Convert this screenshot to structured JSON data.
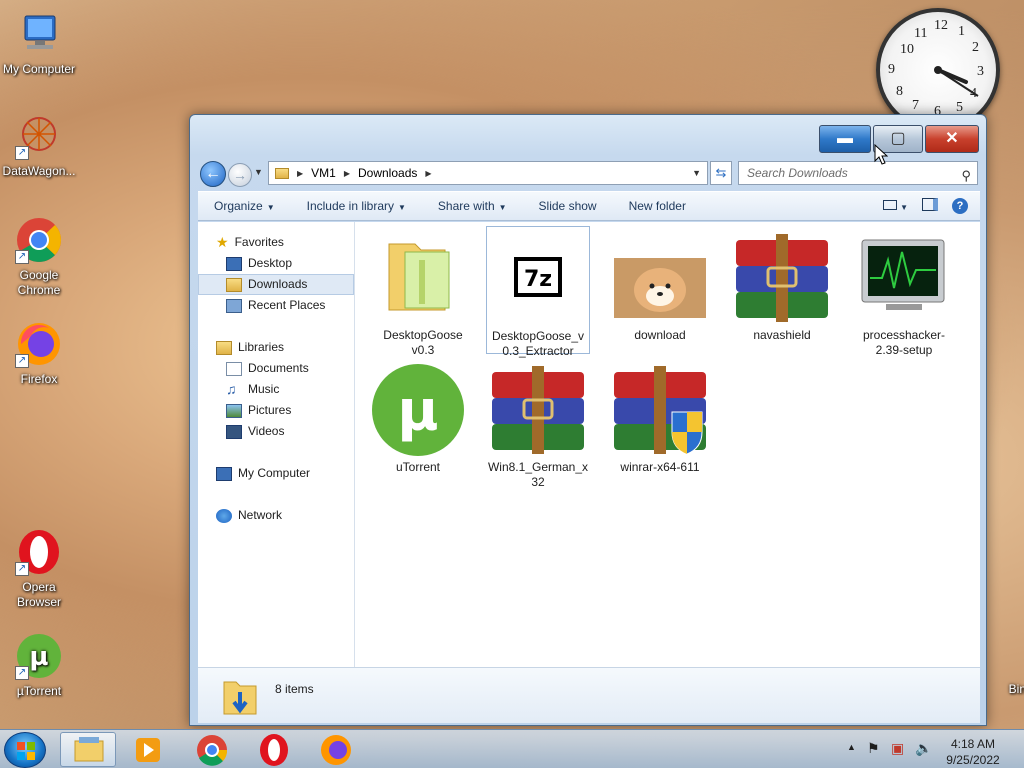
{
  "desktop": {
    "icons": [
      {
        "label": "My Computer"
      },
      {
        "label": "DataWagon..."
      },
      {
        "label": "Google Chrome"
      },
      {
        "label": "Firefox"
      },
      {
        "label": "Opera Browser"
      },
      {
        "label": "µTorrent"
      }
    ],
    "recycle_label": "Bin",
    "clock_numbers": [
      "10",
      "11",
      "12",
      "1",
      "2",
      "3",
      "4",
      "5",
      "6",
      "7",
      "8",
      "9"
    ]
  },
  "window": {
    "address": {
      "root": "VM1",
      "folder": "Downloads"
    },
    "search_placeholder": "Search Downloads",
    "toolbar": {
      "organize": "Organize",
      "include_in_library": "Include in library",
      "share_with": "Share with",
      "slide_show": "Slide show",
      "new_folder": "New folder"
    },
    "nav": {
      "favorites": "Favorites",
      "desktop": "Desktop",
      "downloads": "Downloads",
      "recent_places": "Recent Places",
      "libraries": "Libraries",
      "documents": "Documents",
      "music": "Music",
      "pictures": "Pictures",
      "videos": "Videos",
      "my_computer": "My Computer",
      "network": "Network"
    },
    "files": [
      {
        "name": "DesktopGoose v0.3"
      },
      {
        "name": "DesktopGoose_v0.3_Extractor"
      },
      {
        "name": "download"
      },
      {
        "name": "navashield"
      },
      {
        "name": "processhacker-2.39-setup"
      },
      {
        "name": "uTorrent"
      },
      {
        "name": "Win8.1_German_x32"
      },
      {
        "name": "winrar-x64-611"
      }
    ],
    "status": {
      "item_count": "8 items"
    }
  },
  "taskbar": {
    "time": "4:18 AM",
    "date": "9/25/2022"
  },
  "colors": {
    "accent": "#2c6ec2",
    "close_red": "#c8412d",
    "chrome_red": "#db4437",
    "winrar_red": "#c62828"
  }
}
